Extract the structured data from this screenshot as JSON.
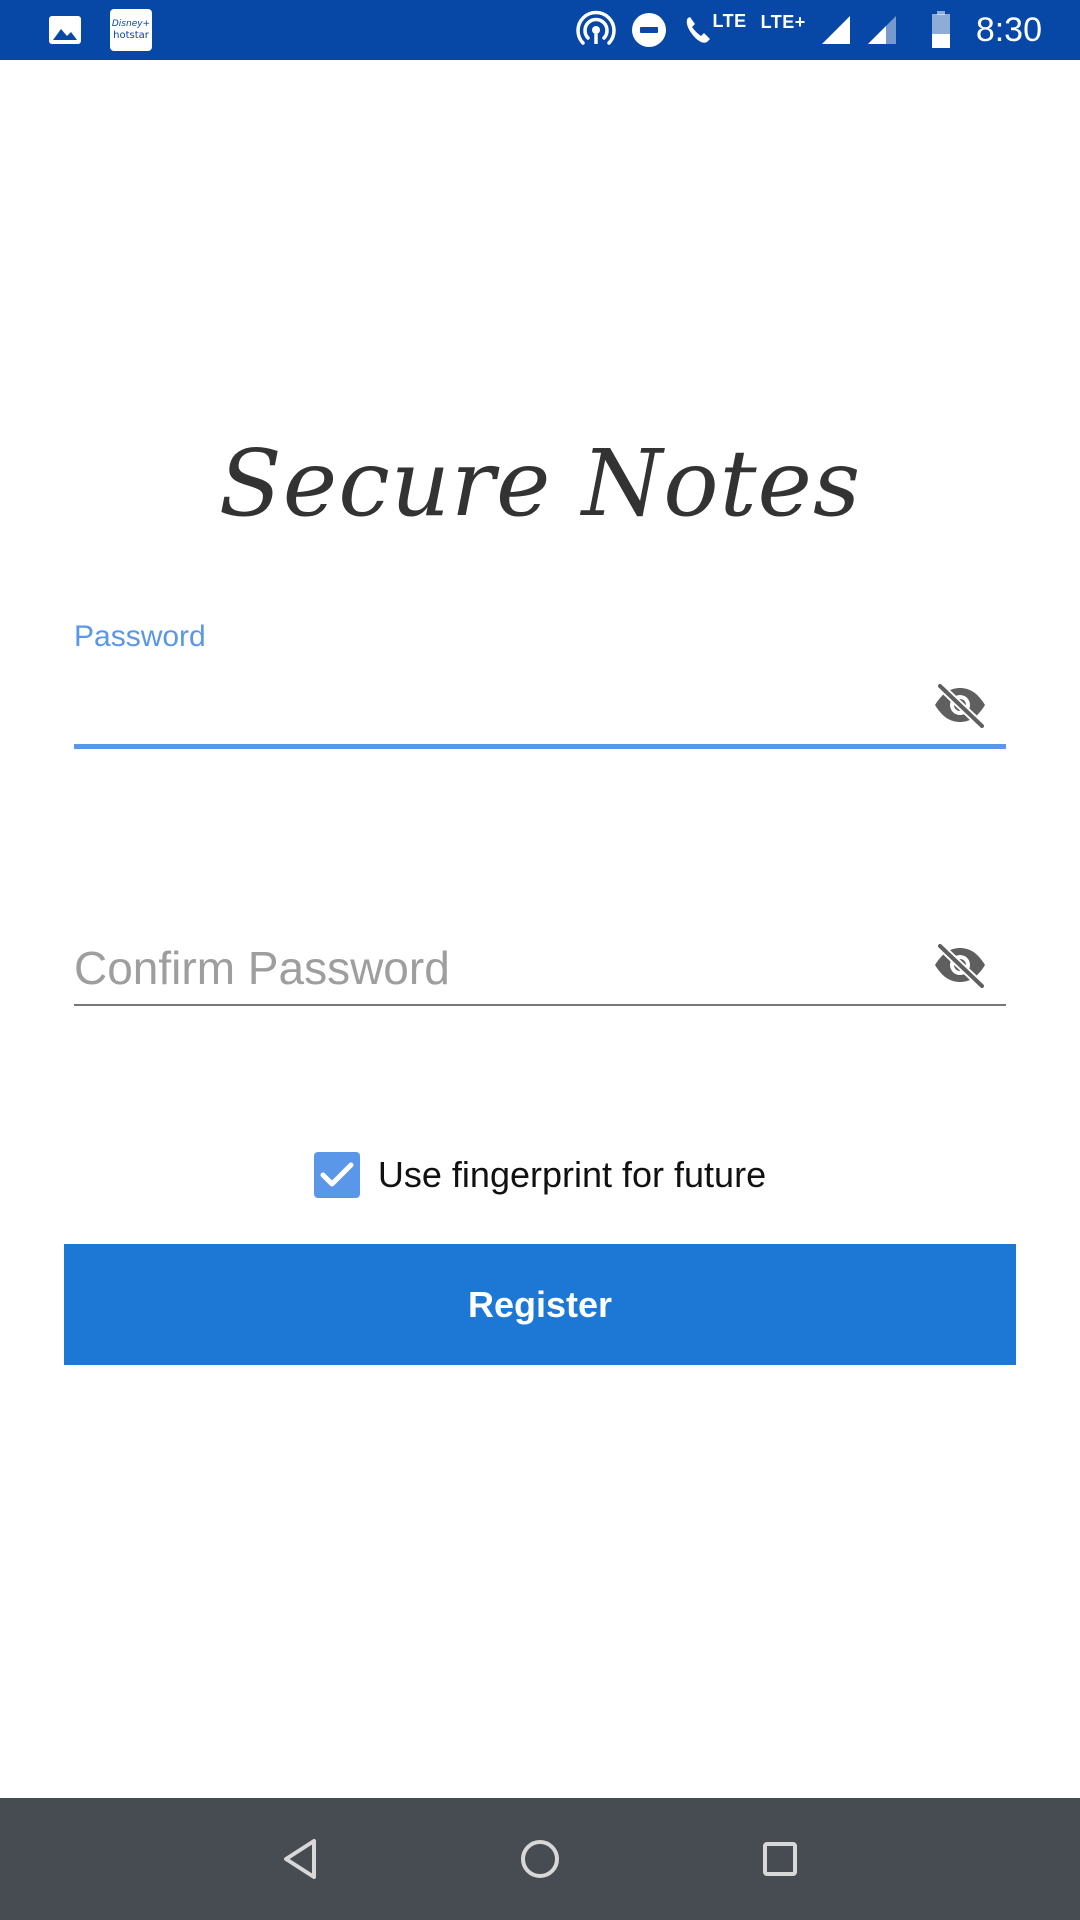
{
  "status_bar": {
    "time": "8:30",
    "lte_call_label": "LTE",
    "lte_plus_label": "LTE+",
    "hotstar_line1": "Disney+",
    "hotstar_line2": "hotstar",
    "icons": [
      "image-icon",
      "hotstar-app-icon",
      "hotspot-icon",
      "do-not-disturb-icon",
      "volte-call-icon",
      "signal-icon",
      "signal-icon-2",
      "battery-icon"
    ],
    "bg_color": "#0747a6"
  },
  "app": {
    "title": "Secure Notes"
  },
  "password_field": {
    "label": "Password",
    "value": "",
    "toggle_icon": "visibility-off-icon",
    "accent_color": "#5b97e8"
  },
  "confirm_field": {
    "placeholder": "Confirm Password",
    "value": "",
    "toggle_icon": "visibility-off-icon"
  },
  "fingerprint_option": {
    "label": "Use fingerprint for future",
    "checked": true
  },
  "register_button": {
    "label": "Register",
    "color": "#1d77d4"
  },
  "nav_bar": {
    "icons": [
      "back-icon",
      "home-icon",
      "recents-icon"
    ],
    "bg_color": "#464c52"
  }
}
